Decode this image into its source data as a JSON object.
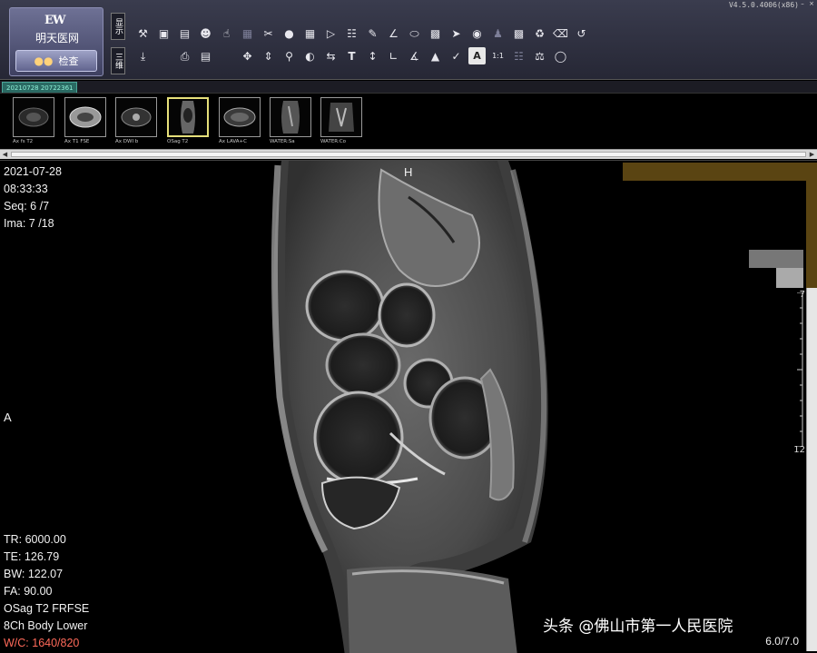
{
  "app": {
    "version": "V4.5.0.4006(x86)",
    "logo_mark": "EW",
    "logo_text": "明天医网",
    "logo_button_label": "检查"
  },
  "toolbar": {
    "mode_tabs": [
      "显示",
      "三维"
    ],
    "row1_icons": [
      "tools-icon",
      "monitor-icon",
      "folder-open-icon",
      "patient-card-icon",
      "hand-pointer-icon",
      "layout-grid-icon",
      "scissors-icon",
      "circle-full-icon",
      "zoom-window-icon",
      "cine-sequence-icon",
      "pencil-icon",
      "angle-icon",
      "ellipse-icon",
      "region-magnify-icon",
      "cursor-arrow-icon",
      "sphere-icon",
      "person-figure-icon",
      "image-document-icon",
      "recycle-icon",
      "eraser-icon",
      "undo-icon"
    ],
    "row2_icons": [
      "download-icon",
      "printer-icon",
      "save-disk-icon",
      "move-arrows-icon",
      "magnifier-icon",
      "contrast-half-icon",
      "sync-series-icon",
      "text-annotation-icon",
      "ruler-measure-icon",
      "polyline-measure-icon",
      "cobb-angle-icon",
      "paint-fill-icon",
      "text-box-icon",
      "one-to-one-icon",
      "skeleton-icon",
      "localizer-icon",
      "circle-outline-icon"
    ]
  },
  "series_tab": "20210728 20722361",
  "thumbnails": [
    {
      "label": "Ax fs T2",
      "selected": false
    },
    {
      "label": "Ax T1 FSE",
      "selected": false
    },
    {
      "label": "Ax DWI b",
      "selected": false
    },
    {
      "label": "OSag T2",
      "selected": true
    },
    {
      "label": "Ax LAVA+C",
      "selected": false
    },
    {
      "label": "WATER:Sa",
      "selected": false
    },
    {
      "label": "WATER:Co",
      "selected": false
    }
  ],
  "overlay": {
    "date": "2021-07-28",
    "time": "08:33:33",
    "seq": "Seq: 6 /7",
    "ima": "Ima: 7 /18",
    "tr": "TR: 6000.00",
    "te": "TE: 126.79",
    "bw": "BW: 122.07",
    "fa": "FA: 90.00",
    "series_desc": "OSag T2 FRFSE",
    "coil": "8Ch Body Lower",
    "wc": "W/C: 1640/820",
    "orient_top": "H",
    "orient_left": "A",
    "zoom": "6.0/7.0",
    "ruler_top": "7",
    "ruler_bottom": "12"
  },
  "watermark": "头条 @佛山市第一人民医院",
  "colors": {
    "toolbar_bg": "#2f3040",
    "selected_thumb": "#e6e07a",
    "wc_text": "#ff6a5a",
    "accent_brown": "#5a4412"
  }
}
